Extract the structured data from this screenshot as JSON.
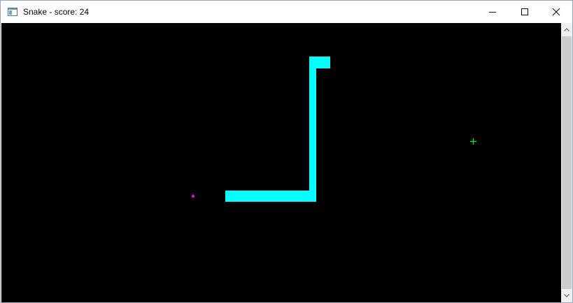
{
  "window": {
    "title": "Snake - score: 24",
    "icon": "app-window-icon"
  },
  "titlebar": {
    "buttons": [
      "minimize-icon",
      "maximize-icon",
      "close-icon"
    ]
  },
  "game": {
    "background_color": "#000000",
    "snake_color": "#00ffff",
    "food_color": "#ff00ff",
    "bonus_color": "#00ff00",
    "score": 24
  },
  "scrollbar": {
    "orientation": "vertical",
    "up_icon": "chevron-up-icon",
    "down_icon": "chevron-down-icon"
  }
}
